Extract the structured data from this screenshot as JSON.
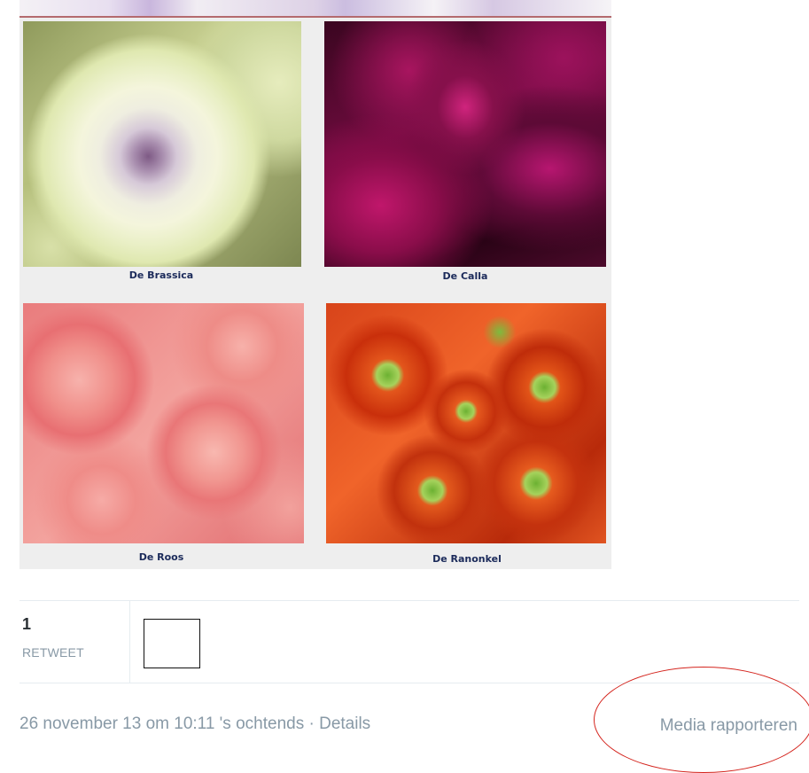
{
  "media": {
    "tiles": [
      {
        "caption": "De Brassica"
      },
      {
        "caption": "De Calla"
      },
      {
        "caption": "De Roos"
      },
      {
        "caption": "De Ranonkel"
      }
    ]
  },
  "stats": {
    "retweet_count": "1",
    "retweet_label": "RETWEET"
  },
  "footer": {
    "timestamp": "26 november 13 om 10:11 's ochtends",
    "separator": "·",
    "details_link": "Details",
    "report_media": "Media rapporteren"
  },
  "colors": {
    "muted_text": "#8899a6",
    "annotation_ring": "#d4241d",
    "caption_text": "#1b2a5a"
  }
}
